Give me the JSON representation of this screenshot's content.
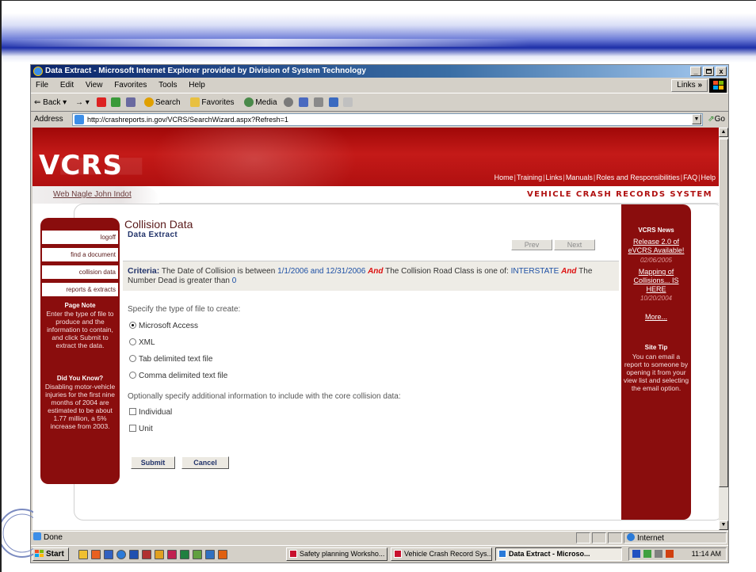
{
  "browser": {
    "title": "Data Extract - Microsoft Internet Explorer provided by Division of System Technology",
    "min": "_",
    "max": " ",
    "close": "x",
    "menus": [
      "File",
      "Edit",
      "View",
      "Favorites",
      "Tools",
      "Help"
    ],
    "links_label": "Links",
    "toolbar": {
      "back": "Back",
      "forward": "→",
      "search": "Search",
      "favorites": "Favorites",
      "media": "Media"
    },
    "address_label": "Address",
    "address_url": "http://crashreports.in.gov/VCRS/SearchWizard.aspx?Refresh=1",
    "go_label": "Go",
    "status_text": "Done",
    "zone": "Internet"
  },
  "site": {
    "logo": "VCRS",
    "nav": [
      "Home",
      "Training",
      "Links",
      "Manuals",
      "Roles and Responsibilities",
      "FAQ",
      "Help"
    ],
    "user": "Web Nagle John Indot",
    "system_name": "VEHICLE CRASH RECORDS SYSTEM"
  },
  "sidebar": {
    "items": [
      "logoff",
      "find a document",
      "collision data",
      "reports & extracts"
    ],
    "page_note_title": "Page Note",
    "page_note": "Enter the type of file to produce and the information to contain, and click Submit to extract the data.",
    "did_you_know_title": "Did You Know?",
    "did_you_know": "Disabling motor-vehicle injuries for the first nine months of 2004 are estimated to be about 1.77 million, a 5% increase from 2003."
  },
  "news": {
    "title": "VCRS News",
    "items": [
      {
        "label": "Release 2.0 of eVCRS Available!",
        "date": "02/06/2005"
      },
      {
        "label": "Mapping of Collisions... IS HERE",
        "date": "10/20/2004"
      }
    ],
    "more": "More...",
    "tip_title": "Site Tip",
    "tip": "You can email a report to someone by opening it from your view list and selecting the email option."
  },
  "main": {
    "title": "Collision Data",
    "subtitle": "Data Extract",
    "prev": "Prev",
    "next": "Next",
    "criteria": {
      "label": "Criteria:",
      "t1": "The Date of Collision is between",
      "v1": "1/1/2006 and 12/31/2006",
      "and": "And",
      "t2": "The Collision Road Class is one of:",
      "v2": "INTERSTATE",
      "t3": "The Number Dead is greater than",
      "v3": "0"
    },
    "file_type_label": "Specify the type of file to create:",
    "file_types": [
      "Microsoft Access",
      "XML",
      "Tab delimited text file",
      "Comma delimited text file"
    ],
    "additional_label": "Optionally specify additional information to include with the core collision data:",
    "additional": [
      "Individual",
      "Unit"
    ],
    "submit": "Submit",
    "cancel": "Cancel"
  },
  "taskbar": {
    "start": "Start",
    "tasks": [
      "Safety planning Worksho...",
      "Vehicle Crash Record Sys...",
      "Data Extract - Microso..."
    ],
    "clock": "11:14 AM"
  },
  "colors": {
    "brand_red": "#8a0d0d",
    "header_red": "#c41a18",
    "link_blue": "#1c4fa4",
    "and_red": "#d11111"
  }
}
